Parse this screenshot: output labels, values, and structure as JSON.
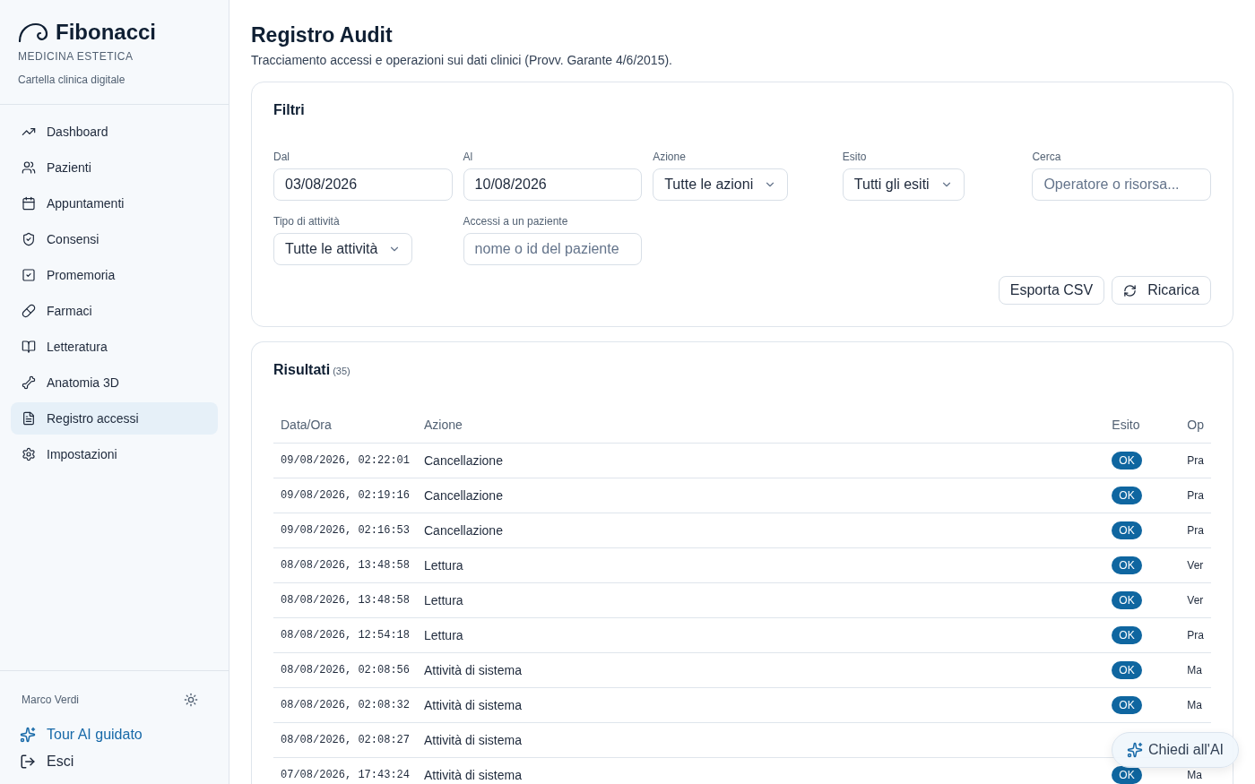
{
  "brand": {
    "name": "Fibonacci",
    "subtitle": "MEDICINA ESTETICA",
    "tagline": "Cartella clinica digitale"
  },
  "nav": [
    {
      "label": "Dashboard",
      "selected": false
    },
    {
      "label": "Pazienti",
      "selected": false
    },
    {
      "label": "Appuntamenti",
      "selected": false
    },
    {
      "label": "Consensi",
      "selected": false
    },
    {
      "label": "Promemoria",
      "selected": false
    },
    {
      "label": "Farmaci",
      "selected": false
    },
    {
      "label": "Letteratura",
      "selected": false
    },
    {
      "label": "Anatomia 3D",
      "selected": false
    },
    {
      "label": "Registro accessi",
      "selected": true
    },
    {
      "label": "Impostazioni",
      "selected": false
    }
  ],
  "user": {
    "name": "Marco Verdi"
  },
  "footer_links": [
    {
      "label": "Tour AI guidato",
      "kind": "accent"
    },
    {
      "label": "Esci",
      "kind": "plain"
    }
  ],
  "page": {
    "title": "Registro Audit",
    "subtitle": "Tracciamento accessi e operazioni sui dati clinici (Provv. Garante 4/6/2015)."
  },
  "filters": {
    "title": "Filtri",
    "fields": [
      {
        "label": "Dal",
        "kind": "input",
        "value": "03/08/2026"
      },
      {
        "label": "Al",
        "kind": "input",
        "value": "10/08/2026"
      },
      {
        "label": "Azione",
        "kind": "select",
        "value": "Tutte le azioni"
      },
      {
        "label": "Esito",
        "kind": "select",
        "value": "Tutti gli esiti"
      },
      {
        "label": "Cerca",
        "kind": "input",
        "placeholder": "Operatore o risorsa..."
      },
      {
        "label": "Tipo di attività",
        "kind": "select",
        "value": "Tutte le attività"
      },
      {
        "label": "Accessi a un paziente",
        "kind": "input",
        "placeholder": "nome o id del paziente"
      }
    ],
    "buttons": [
      {
        "label": "Esporta CSV",
        "kind": "plain"
      },
      {
        "label": "Ricarica",
        "kind": "reload"
      }
    ]
  },
  "results": {
    "title": "Risultati",
    "count": "(35)",
    "columns": [
      "Data/Ora",
      "Azione",
      "Esito",
      "Op"
    ],
    "rows": [
      {
        "time": "09/08/2026, 02:22:01",
        "action": "Cancellazione",
        "outcome": "OK",
        "op": "Pra"
      },
      {
        "time": "09/08/2026, 02:19:16",
        "action": "Cancellazione",
        "outcome": "OK",
        "op": "Pra"
      },
      {
        "time": "09/08/2026, 02:16:53",
        "action": "Cancellazione",
        "outcome": "OK",
        "op": "Pra"
      },
      {
        "time": "08/08/2026, 13:48:58",
        "action": "Lettura",
        "outcome": "OK",
        "op": "Ver"
      },
      {
        "time": "08/08/2026, 13:48:58",
        "action": "Lettura",
        "outcome": "OK",
        "op": "Ver"
      },
      {
        "time": "08/08/2026, 12:54:18",
        "action": "Lettura",
        "outcome": "OK",
        "op": "Pra"
      },
      {
        "time": "08/08/2026, 02:08:56",
        "action": "Attività di sistema",
        "outcome": "OK",
        "op": "Ma"
      },
      {
        "time": "08/08/2026, 02:08:32",
        "action": "Attività di sistema",
        "outcome": "OK",
        "op": "Ma"
      },
      {
        "time": "08/08/2026, 02:08:27",
        "action": "Attività di sistema"
      },
      {
        "time": "07/08/2026, 17:43:24",
        "action": "Attività di sistema",
        "outcome": "OK",
        "op": "Ma"
      }
    ]
  },
  "assistant_button": {
    "label": "Chiedi all'AI"
  }
}
